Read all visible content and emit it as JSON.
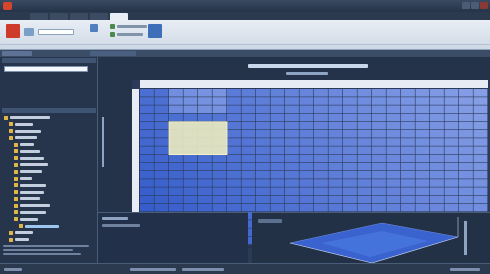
{
  "window": {
    "title": ""
  },
  "colors": {
    "accent": "#d4462a",
    "map_low": "#2f57c8",
    "map_high": "#9fb3ee",
    "selection": "#ecebc0",
    "folder": "#e0b64a"
  },
  "icons": [
    "app-logo-icon",
    "minimize-icon",
    "maximize-icon",
    "close-icon",
    "folder-icon",
    "table-icon",
    "play-icon",
    "first-icon",
    "previous-icon",
    "next-icon",
    "last-icon",
    "chevron-down-icon"
  ],
  "map_grid": {
    "cell_values": []
  },
  "statusbar": {
    "text": ""
  }
}
